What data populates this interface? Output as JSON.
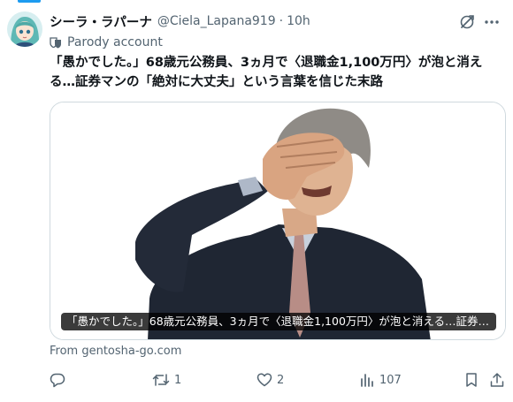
{
  "tweet": {
    "display_name": "シーラ・ラパーナ",
    "handle": "@Ciela_Lapana919",
    "separator": "·",
    "time": "10h",
    "parody_label": "Parody account",
    "text": "「愚かでした。」68歳元公務員、3ヵ月で〈退職金1,100万円〉が泡と消える…証券マンの「絶対に大丈夫」という言葉を信じた末路"
  },
  "media": {
    "caption": "「愚かでした。」68歳元公務員、3ヵ月で〈退職金1,100万円〉が泡と消える…証券マンの「絶対に大丈夫」という言葉を信じた末路",
    "source": "From gentosha-go.com"
  },
  "actions": {
    "reply_count": "",
    "retweet_count": "1",
    "like_count": "2",
    "view_count": "107"
  },
  "colors": {
    "accent": "#1d9bf0",
    "text_primary": "#0f1419",
    "text_secondary": "#536471",
    "border": "#cfd9de"
  },
  "icons": {
    "grok": "grok-icon",
    "more": "more-icon",
    "parody": "parody-mask-icon",
    "reply": "reply-icon",
    "retweet": "retweet-icon",
    "like": "heart-icon",
    "views": "views-icon",
    "bookmark": "bookmark-icon",
    "share": "share-icon"
  }
}
